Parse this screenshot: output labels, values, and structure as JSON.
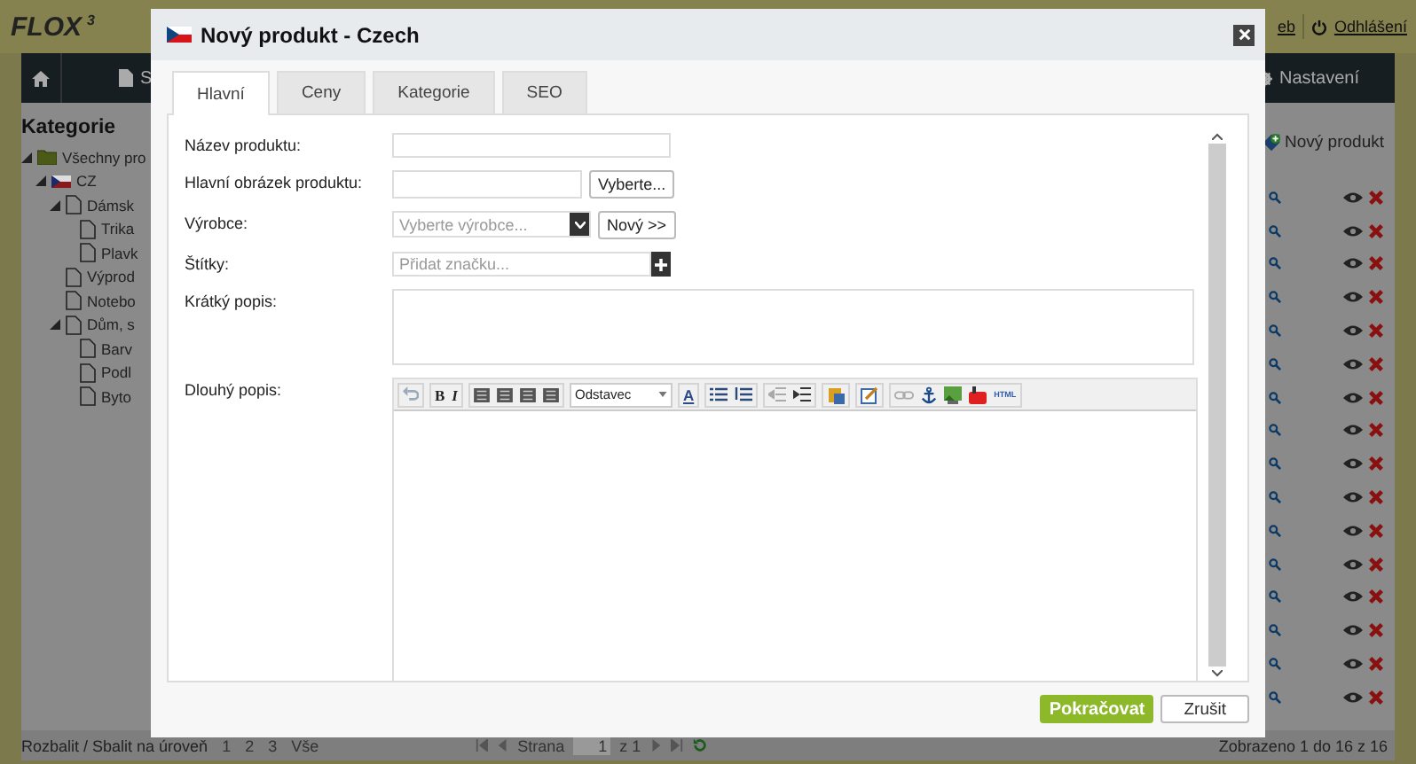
{
  "header": {
    "logo": "FLOX",
    "logo_sup": "3",
    "links": [
      {
        "label": "eb",
        "kind": "plain"
      },
      {
        "label": "Odhlášení",
        "kind": "logout"
      }
    ]
  },
  "nav": {
    "items": [
      {
        "label": "S",
        "kind": "page"
      },
      {
        "label": "Nastavení",
        "kind": "settings"
      }
    ]
  },
  "sidebar": {
    "title": "Kategorie",
    "tree": [
      {
        "label": "Všechny pro",
        "kind": "folder",
        "expanded": true,
        "children": [
          {
            "label": "CZ",
            "kind": "flag",
            "expanded": true,
            "children": [
              {
                "label": "Dámsk",
                "kind": "page",
                "expanded": true,
                "children": [
                  {
                    "label": "Trika",
                    "kind": "page"
                  },
                  {
                    "label": "Plavk",
                    "kind": "page"
                  }
                ]
              },
              {
                "label": "Výprod",
                "kind": "page"
              },
              {
                "label": "Notebo",
                "kind": "page"
              },
              {
                "label": "Dům, s",
                "kind": "page",
                "expanded": true,
                "children": [
                  {
                    "label": "Barv",
                    "kind": "page"
                  },
                  {
                    "label": "Podl",
                    "kind": "page"
                  },
                  {
                    "label": "Byto",
                    "kind": "page"
                  }
                ]
              }
            ]
          }
        ]
      }
    ]
  },
  "toolbar": {
    "new_button": "Nový produkt"
  },
  "footer": {
    "expand_label": "Rozbalit / Sbalit na úroveň",
    "levels": [
      "1",
      "2",
      "3",
      "Vše"
    ],
    "page_label": "Strana",
    "page": "1",
    "page_of": "z 1",
    "summary": "Zobrazeno 1 do 16 z 16"
  },
  "dialog": {
    "title": "Nový produkt - Czech",
    "tabs": [
      {
        "label": "Hlavní",
        "selected": true
      },
      {
        "label": "Ceny",
        "selected": false
      },
      {
        "label": "Kategorie",
        "selected": false
      },
      {
        "label": "SEO",
        "selected": false
      }
    ],
    "fields": [
      {
        "kind": "text",
        "label": "Název produktu:"
      },
      {
        "kind": "file",
        "label": "Hlavní obrázek produktu:",
        "button": "Vyberte..."
      },
      {
        "kind": "select",
        "label": "Výrobce:",
        "placeholder": "Vyberte výrobce...",
        "button": "Nový >>"
      },
      {
        "kind": "tags",
        "label": "Štítky:",
        "placeholder": "Přidat značku..."
      },
      {
        "kind": "textarea",
        "label": "Krátký popis:"
      },
      {
        "kind": "editor",
        "label": "Dlouhý popis:",
        "bold": "B",
        "italic": "I",
        "format": "Odstavec",
        "font_color": "A",
        "html": "HTML"
      }
    ],
    "buttons": {
      "primary": "Pokračovat",
      "cancel": "Zrušit"
    }
  }
}
